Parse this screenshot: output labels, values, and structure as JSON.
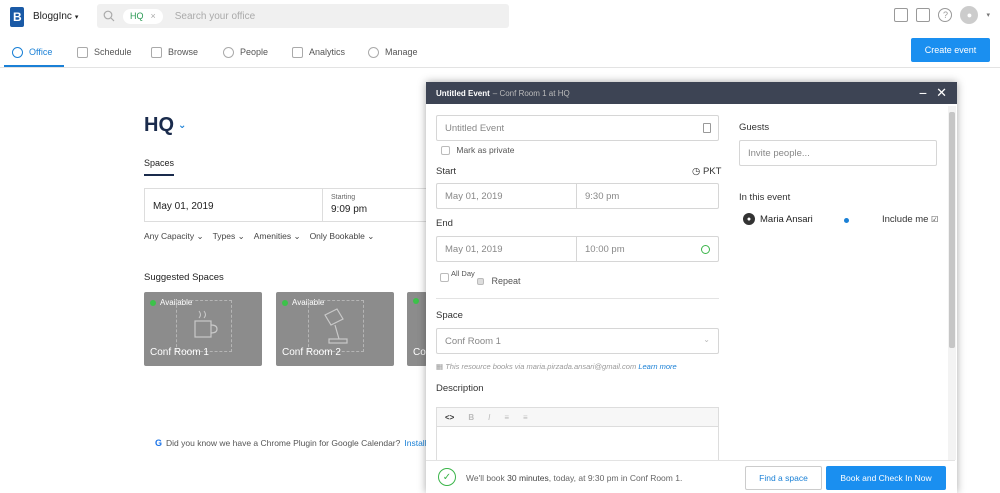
{
  "topbar": {
    "org_name": "BloggInc",
    "search_chip": "HQ",
    "search_placeholder": "Search your office"
  },
  "nav": {
    "items": [
      {
        "label": "Office",
        "icon": "search-icon",
        "active": true
      },
      {
        "label": "Schedule",
        "icon": "calendar-icon"
      },
      {
        "label": "Browse",
        "icon": "browse-icon"
      },
      {
        "label": "People",
        "icon": "person-icon"
      },
      {
        "label": "Analytics",
        "icon": "bar-chart-icon"
      },
      {
        "label": "Manage",
        "icon": "gear-icon"
      }
    ],
    "create_label": "Create event"
  },
  "office": {
    "title": "HQ",
    "tab": "Spaces",
    "date": "May 01, 2019",
    "starting_label": "Starting",
    "starting_time": "9:09 pm",
    "filters": [
      "Any Capacity",
      "Types",
      "Amenities",
      "Only Bookable"
    ],
    "suggested_title": "Suggested Spaces",
    "cards": [
      {
        "status": "Available",
        "name": "Conf Room 1"
      },
      {
        "status": "Available",
        "name": "Conf Room 2"
      },
      {
        "status": "",
        "name": "Co"
      }
    ],
    "tip_text": "Did you know we have a Chrome Plugin for Google Calendar?",
    "tip_link": "Install"
  },
  "modal": {
    "title": "Untitled Event",
    "subtitle": "– Conf Room 1 at  HQ",
    "event_placeholder": "Untitled Event",
    "mark_private": "Mark as private",
    "start_label": "Start",
    "timezone": "PKT",
    "start_date": "May 01, 2019",
    "start_time": "9:30 pm",
    "end_label": "End",
    "end_date": "May 01, 2019",
    "end_time": "10:00 pm",
    "all_day": "All Day",
    "repeat": "Repeat",
    "space_label": "Space",
    "space_value": "Conf Room 1",
    "resource_note": "This resource books via maria.pirzada.ansari@gmail.com",
    "learn_more": "Learn more",
    "description_label": "Description",
    "editor_tools": [
      "<>",
      "B",
      "I",
      "≡",
      "≡"
    ],
    "guests_label": "Guests",
    "guests_placeholder": "Invite people...",
    "in_event_label": "In this event",
    "guest_name": "Maria Ansari",
    "include_me": "Include me",
    "footer_msg_prefix": "We'll book",
    "footer_msg_bold": "30 minutes",
    "footer_msg_suffix": ", today, at 9:30 pm in Conf Room 1.",
    "find_space": "Find a space",
    "book_now": "Book and Check In Now"
  }
}
